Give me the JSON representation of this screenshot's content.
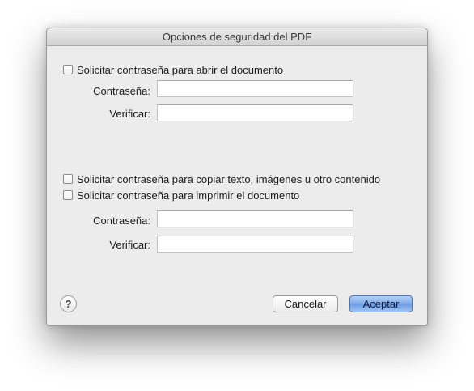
{
  "window": {
    "title": "Opciones de seguridad del PDF"
  },
  "open_section": {
    "checkbox_label": "Solicitar contraseña para abrir el documento",
    "checked": false,
    "password_label": "Contraseña:",
    "password_value": "",
    "verify_label": "Verificar:",
    "verify_value": ""
  },
  "permissions_section": {
    "copy_checkbox_label": "Solicitar contraseña para copiar texto, imágenes u otro contenido",
    "copy_checked": false,
    "print_checkbox_label": "Solicitar contraseña para imprimir el documento",
    "print_checked": false,
    "password_label": "Contraseña:",
    "password_value": "",
    "verify_label": "Verificar:",
    "verify_value": ""
  },
  "footer": {
    "help_label": "?",
    "cancel_label": "Cancelar",
    "accept_label": "Aceptar"
  },
  "colors": {
    "dialog_background": "#ececec",
    "default_button": "#7ea9ea"
  }
}
